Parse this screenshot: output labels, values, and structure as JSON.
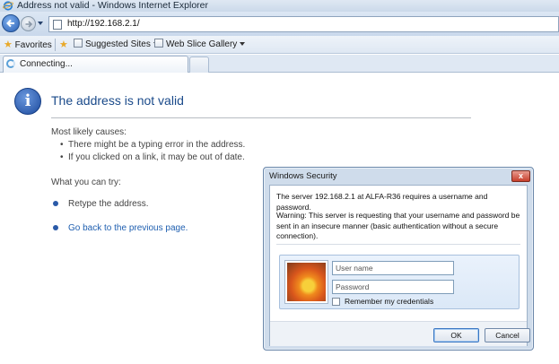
{
  "window": {
    "title": "Address not valid - Windows Internet Explorer"
  },
  "address_bar": {
    "url": "http://192.168.2.1/"
  },
  "favorites_bar": {
    "favorites_label": "Favorites",
    "suggested_sites_label": "Suggested Sites",
    "web_slice_gallery_label": "Web Slice Gallery"
  },
  "tab": {
    "label": "Connecting..."
  },
  "error_page": {
    "title": "The address is not valid",
    "causes_heading": "Most likely causes:",
    "causes": [
      "There might be a typing error in the address.",
      "If you clicked on a link, it may be out of date."
    ],
    "try_heading": "What you can try:",
    "try_items": [
      "Retype the address.",
      "Go back to the previous page."
    ]
  },
  "dialog": {
    "title": "Windows Security",
    "message": "The server 192.168.2.1 at ALFA-R36 requires a username and password.",
    "warning": "Warning: This server is requesting that your username and password be sent in an insecure manner (basic authentication without a secure connection).",
    "username_placeholder": "User name",
    "password_placeholder": "Password",
    "remember_label": "Remember my credentials",
    "ok_label": "OK",
    "cancel_label": "Cancel",
    "close_glyph": "x"
  }
}
